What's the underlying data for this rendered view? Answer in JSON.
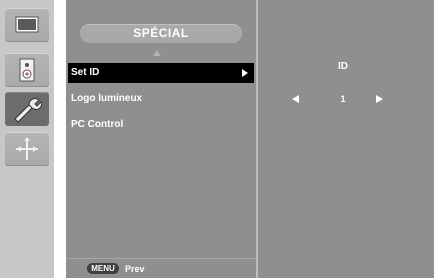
{
  "rail": {
    "icons": [
      {
        "name": "picture-icon",
        "active": false
      },
      {
        "name": "audio-speaker-icon",
        "active": false
      },
      {
        "name": "options-wrench-icon",
        "active": true
      },
      {
        "name": "special-arrows-icon",
        "active": false
      }
    ]
  },
  "menu": {
    "title": "SPÉCIAL",
    "items": [
      {
        "label": "Set ID",
        "selected": true
      },
      {
        "label": "Logo lumineux",
        "selected": false
      },
      {
        "label": "PC Control",
        "selected": false
      }
    ],
    "footer": {
      "key": "MENU",
      "label": "Prev"
    }
  },
  "value_panel": {
    "label": "ID",
    "value": "1"
  },
  "colors": {
    "panel": "#8f8f8f",
    "selected": "#000000",
    "rail": "#c7c7c7",
    "text": "#ffffff"
  }
}
